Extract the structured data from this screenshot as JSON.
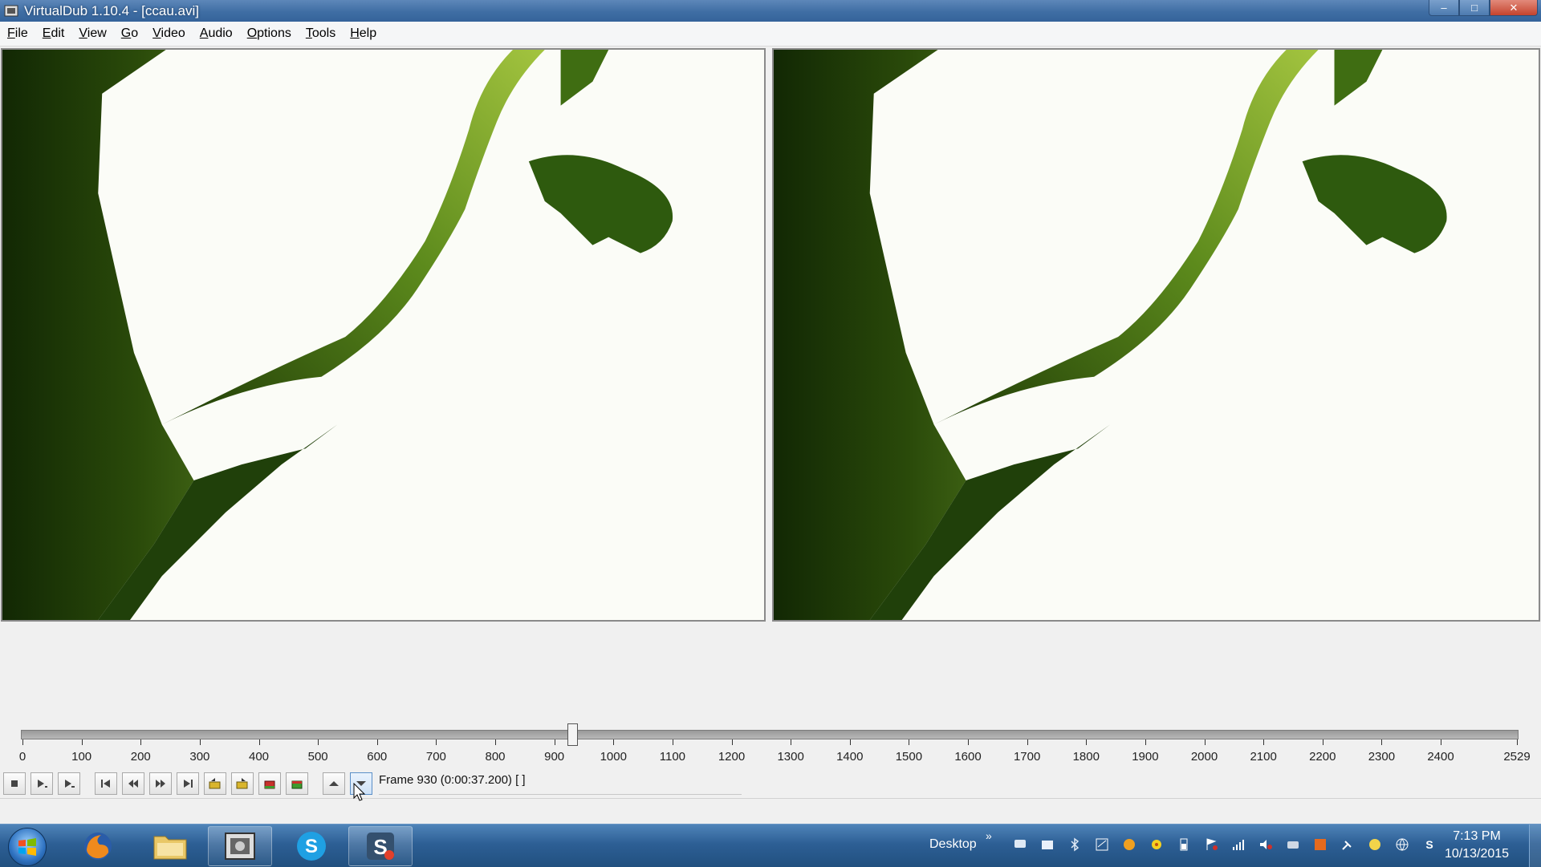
{
  "window": {
    "title": "VirtualDub 1.10.4 - [ccau.avi]",
    "controls": {
      "minimize": "–",
      "maximize": "□",
      "close": "✕"
    }
  },
  "menu": [
    {
      "u": "F",
      "rest": "ile"
    },
    {
      "u": "E",
      "rest": "dit"
    },
    {
      "u": "V",
      "rest": "iew"
    },
    {
      "u": "G",
      "rest": "o"
    },
    {
      "u": "V",
      "rest": "ideo"
    },
    {
      "u": "A",
      "rest": "udio"
    },
    {
      "u": "O",
      "rest": "ptions"
    },
    {
      "u": "T",
      "rest": "ools"
    },
    {
      "u": "H",
      "rest": "elp"
    }
  ],
  "timeline": {
    "current_frame": 930,
    "total_frames": 2529,
    "tick_labels": [
      "0",
      "100",
      "200",
      "300",
      "400",
      "500",
      "600",
      "700",
      "800",
      "900",
      "1000",
      "1100",
      "1200",
      "1300",
      "1400",
      "1500",
      "1600",
      "1700",
      "1800",
      "1900",
      "2000",
      "2100",
      "2200",
      "2300",
      "2400",
      "2529"
    ]
  },
  "status": {
    "frame_text": "Frame 930 (0:00:37.200) [ ]"
  },
  "toolbar": {
    "buttons": [
      {
        "icon": "stop-icon"
      },
      {
        "icon": "play-input-icon"
      },
      {
        "icon": "play-output-icon"
      },
      {
        "icon": "go-start-icon"
      },
      {
        "icon": "prev-frame-icon"
      },
      {
        "icon": "next-frame-icon"
      },
      {
        "icon": "go-end-icon"
      },
      {
        "icon": "prev-keyframe-icon"
      },
      {
        "icon": "next-keyframe-icon"
      },
      {
        "icon": "scene-back-icon"
      },
      {
        "icon": "scene-forward-icon"
      },
      {
        "icon": "mark-in-icon"
      },
      {
        "icon": "mark-out-icon"
      }
    ]
  },
  "taskbar": {
    "apps": [
      {
        "name": "firefox"
      },
      {
        "name": "file-explorer"
      },
      {
        "name": "virtualdub"
      },
      {
        "name": "skype"
      },
      {
        "name": "snagit"
      }
    ],
    "desktop_label": "Desktop",
    "desktop_chevron": "»",
    "clock": {
      "time": "7:13 PM",
      "date": "10/13/2015"
    }
  },
  "colors": {
    "titlebar": "#3f6ea4",
    "taskbar": "#2d5f95",
    "foliage_dark": "#1b3606",
    "foliage_light": "#7fa32c"
  }
}
